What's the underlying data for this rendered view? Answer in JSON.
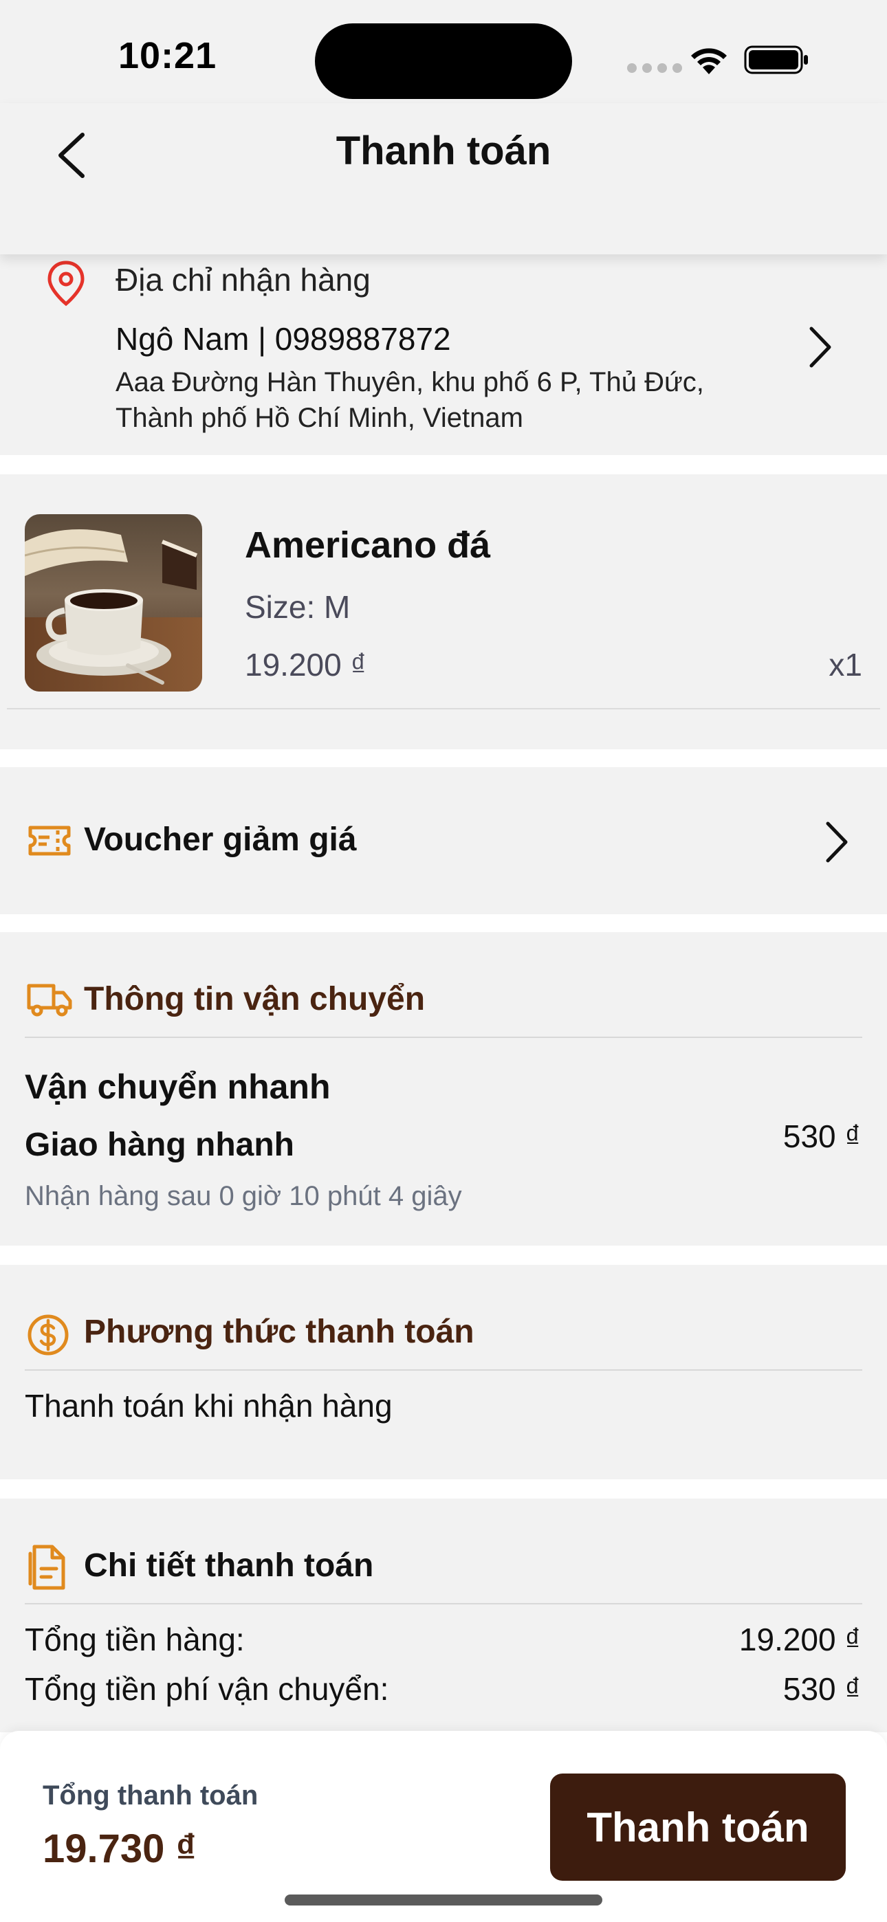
{
  "status_bar": {
    "time": "10:21"
  },
  "nav": {
    "title": "Thanh toán",
    "back_icon": "chevron-left-icon"
  },
  "address": {
    "label": "Địa chỉ nhận hàng",
    "name_phone": "Ngô Nam | 0989887872",
    "line": "Aaa Đường Hàn Thuyên, khu phố 6 P, Thủ Đức, Thành phố Hồ Chí Minh, Vietnam"
  },
  "product": {
    "name": "Americano đá",
    "size": "Size: M",
    "price": "19.200 ₫",
    "qty": "x1"
  },
  "voucher": {
    "label": "Voucher giảm giá"
  },
  "shipping": {
    "title": "Thông tin vận chuyển",
    "method": "Vận chuyển nhanh",
    "name": "Giao hàng nhanh",
    "fee": "530 ₫",
    "eta": "Nhận hàng sau 0 giờ 10 phút 4 giây"
  },
  "payment": {
    "title": "Phương thức thanh toán",
    "method": "Thanh toán khi nhận hàng"
  },
  "details": {
    "title": "Chi tiết thanh toán",
    "rows": [
      {
        "label": "Tổng tiền hàng:",
        "value": "19.200 ₫"
      },
      {
        "label": "Tổng tiền phí vận chuyển:",
        "value": "530 ₫"
      }
    ]
  },
  "footer": {
    "total_label": "Tổng thanh toán",
    "total_value": "19.730 ₫",
    "checkout_label": "Thanh toán"
  },
  "colors": {
    "accent_orange": "#e08a1e",
    "brown_dark": "#3d1c0e",
    "title_brown": "#4a2411",
    "pin_red": "#e5332a"
  }
}
